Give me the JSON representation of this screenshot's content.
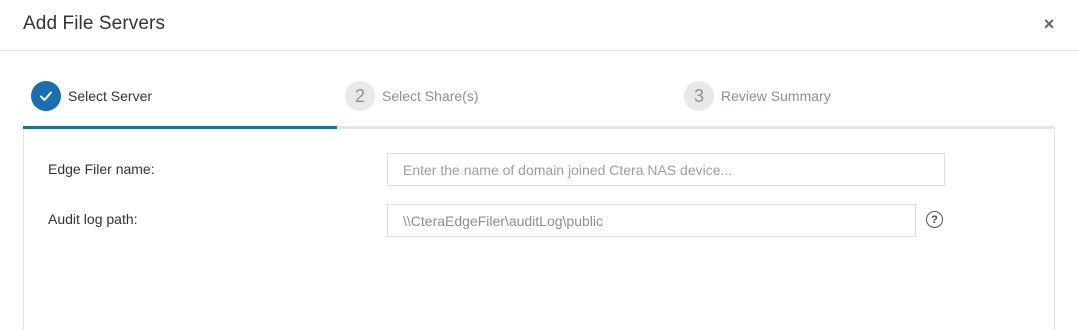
{
  "dialog": {
    "title": "Add File Servers",
    "close_label": "×"
  },
  "steps": [
    {
      "number": "",
      "label": "Select Server",
      "status": "done"
    },
    {
      "number": "2",
      "label": "Select Share(s)",
      "status": "todo"
    },
    {
      "number": "3",
      "label": "Review Summary",
      "status": "todo"
    }
  ],
  "form": {
    "edge_filer_label": "Edge Filer name:",
    "edge_filer_value": "",
    "edge_filer_placeholder": "Enter the name of domain joined Ctera NAS device...",
    "audit_log_label": "Audit log path:",
    "audit_log_value": "\\\\CteraEdgeFiler\\auditLog\\public",
    "help_label": "?"
  },
  "colors": {
    "accent": "#1a6fb1",
    "inactive_step": "#e6e8ea"
  }
}
